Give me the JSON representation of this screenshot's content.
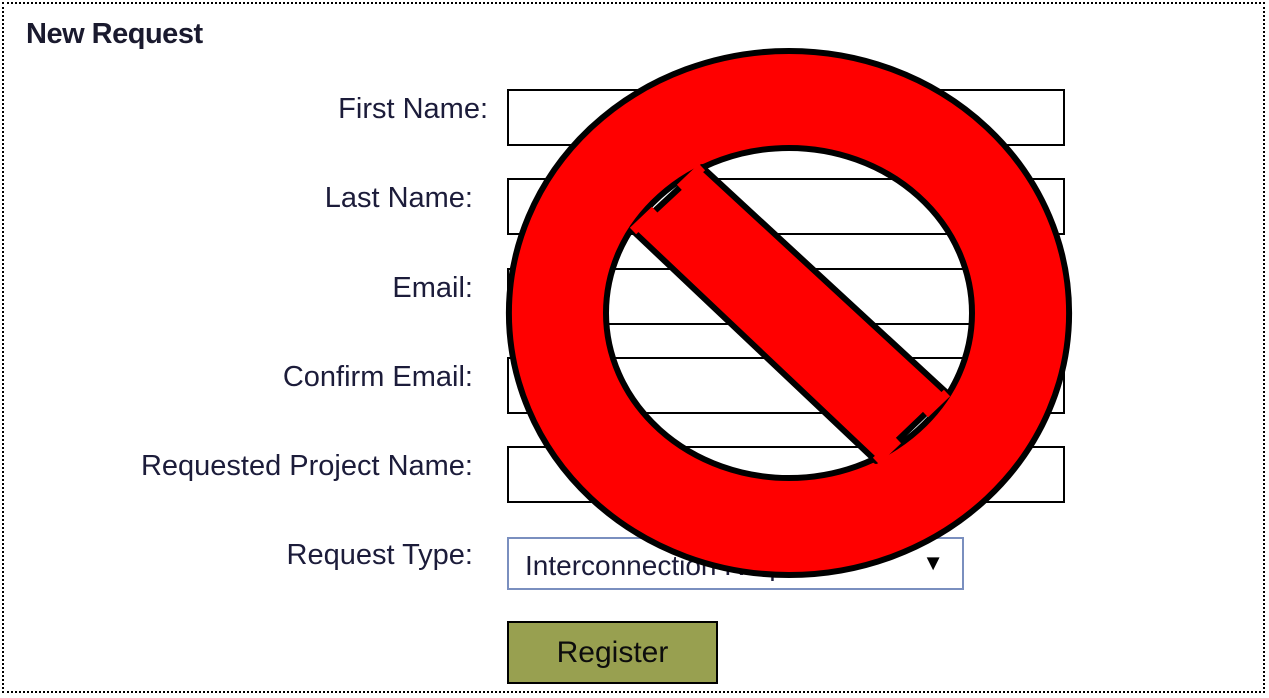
{
  "form": {
    "title": "New Request",
    "fields": [
      {
        "label": "First Name:",
        "value": ""
      },
      {
        "label": "Last Name:",
        "value": ""
      },
      {
        "label": "Email:",
        "value": ""
      },
      {
        "label": "Confirm Email:",
        "value": ""
      },
      {
        "label": "Requested Project Name:",
        "value": ""
      }
    ],
    "request_type": {
      "label": "Request Type:",
      "selected": "Interconnection Request"
    },
    "submit_label": "Register"
  },
  "overlay": {
    "icon": "no-symbol-icon",
    "fill_color": "#ff0000",
    "stroke_color": "#000000"
  },
  "colors": {
    "button_bg": "#98a050",
    "select_border": "#7a8fbf"
  }
}
